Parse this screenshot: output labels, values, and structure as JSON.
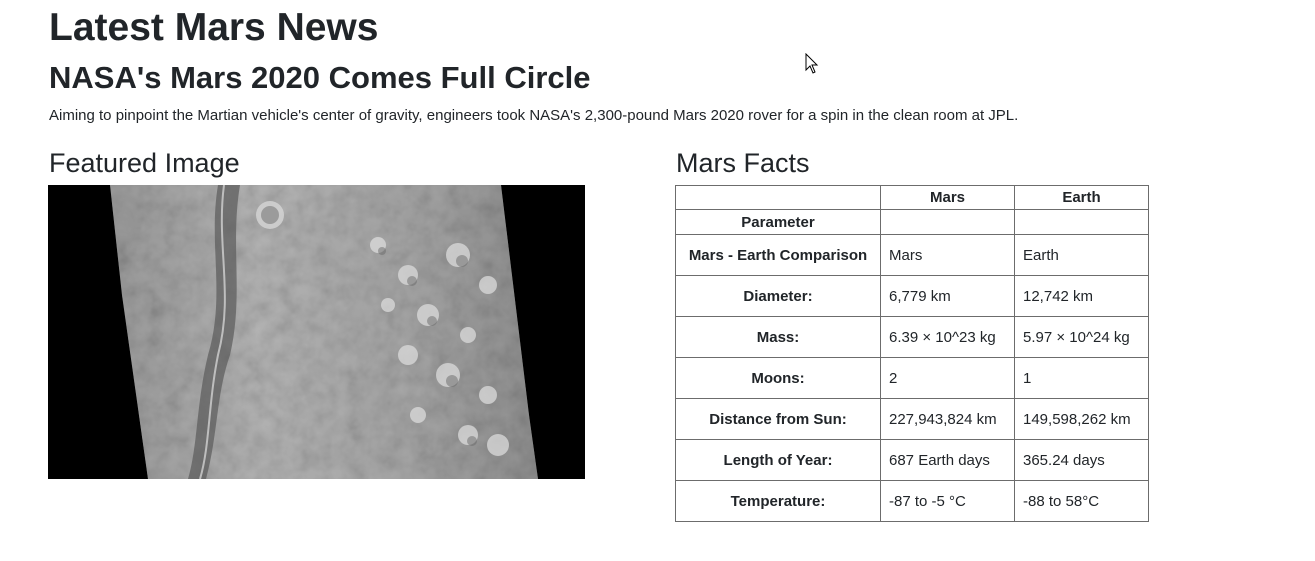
{
  "page": {
    "title": "Latest Mars News"
  },
  "news": {
    "title": "NASA's Mars 2020 Comes Full Circle",
    "teaser": "Aiming to pinpoint the Martian vehicle's center of gravity, engineers took NASA's 2,300-pound Mars 2020 rover for a spin in the clean room at JPL."
  },
  "featured": {
    "heading": "Featured Image"
  },
  "facts": {
    "heading": "Mars Facts",
    "header": {
      "param": "",
      "mars": "Mars",
      "earth": "Earth"
    },
    "param_label": "Parameter",
    "rows": [
      {
        "label": "Mars - Earth Comparison",
        "mars": "Mars",
        "earth": "Earth"
      },
      {
        "label": "Diameter:",
        "mars": "6,779 km",
        "earth": "12,742 km"
      },
      {
        "label": "Mass:",
        "mars": "6.39 × 10^23 kg",
        "earth": "5.97 × 10^24 kg"
      },
      {
        "label": "Moons:",
        "mars": "2",
        "earth": "1"
      },
      {
        "label": "Distance from Sun:",
        "mars": "227,943,824 km",
        "earth": "149,598,262 km"
      },
      {
        "label": "Length of Year:",
        "mars": "687 Earth days",
        "earth": "365.24 days"
      },
      {
        "label": "Temperature:",
        "mars": "-87 to -5 °C",
        "earth": "-88 to 58°C"
      }
    ]
  },
  "icons": {
    "cursor": "mouse-pointer-icon"
  }
}
